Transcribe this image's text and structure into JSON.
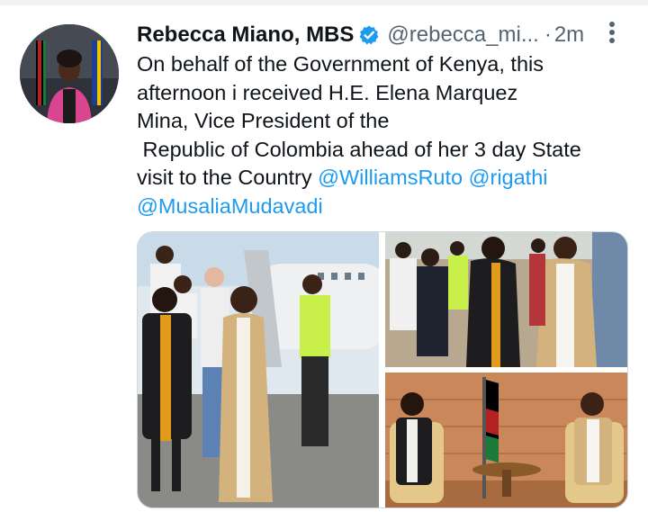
{
  "tweet": {
    "author_name": "Rebecca Miano, MBS",
    "handle": "@rebecca_mi...",
    "separator": "·",
    "time": "2m",
    "verified_icon": "verified-badge-icon",
    "more_icon": "more-options-icon",
    "text_lines": [
      "On behalf of the Government of Kenya, this",
      "afternoon i received H.E. Elena Marquez",
      "Mina, Vice President of the",
      " Republic of Colombia ahead of her 3 day State",
      "visit to the Country "
    ],
    "mentions": {
      "ruto": "@WilliamsRuto",
      "rigathi": "@rigathi",
      "mudavadi": "@MusaliaMudavadi"
    },
    "media": [
      {
        "name": "airport-arrival-photo"
      },
      {
        "name": "greeting-photo"
      },
      {
        "name": "meeting-room-photo"
      }
    ]
  },
  "colors": {
    "link": "#1d9bf0",
    "text": "#0f1419",
    "muted": "#536471",
    "verified": "#1d9bf0"
  }
}
